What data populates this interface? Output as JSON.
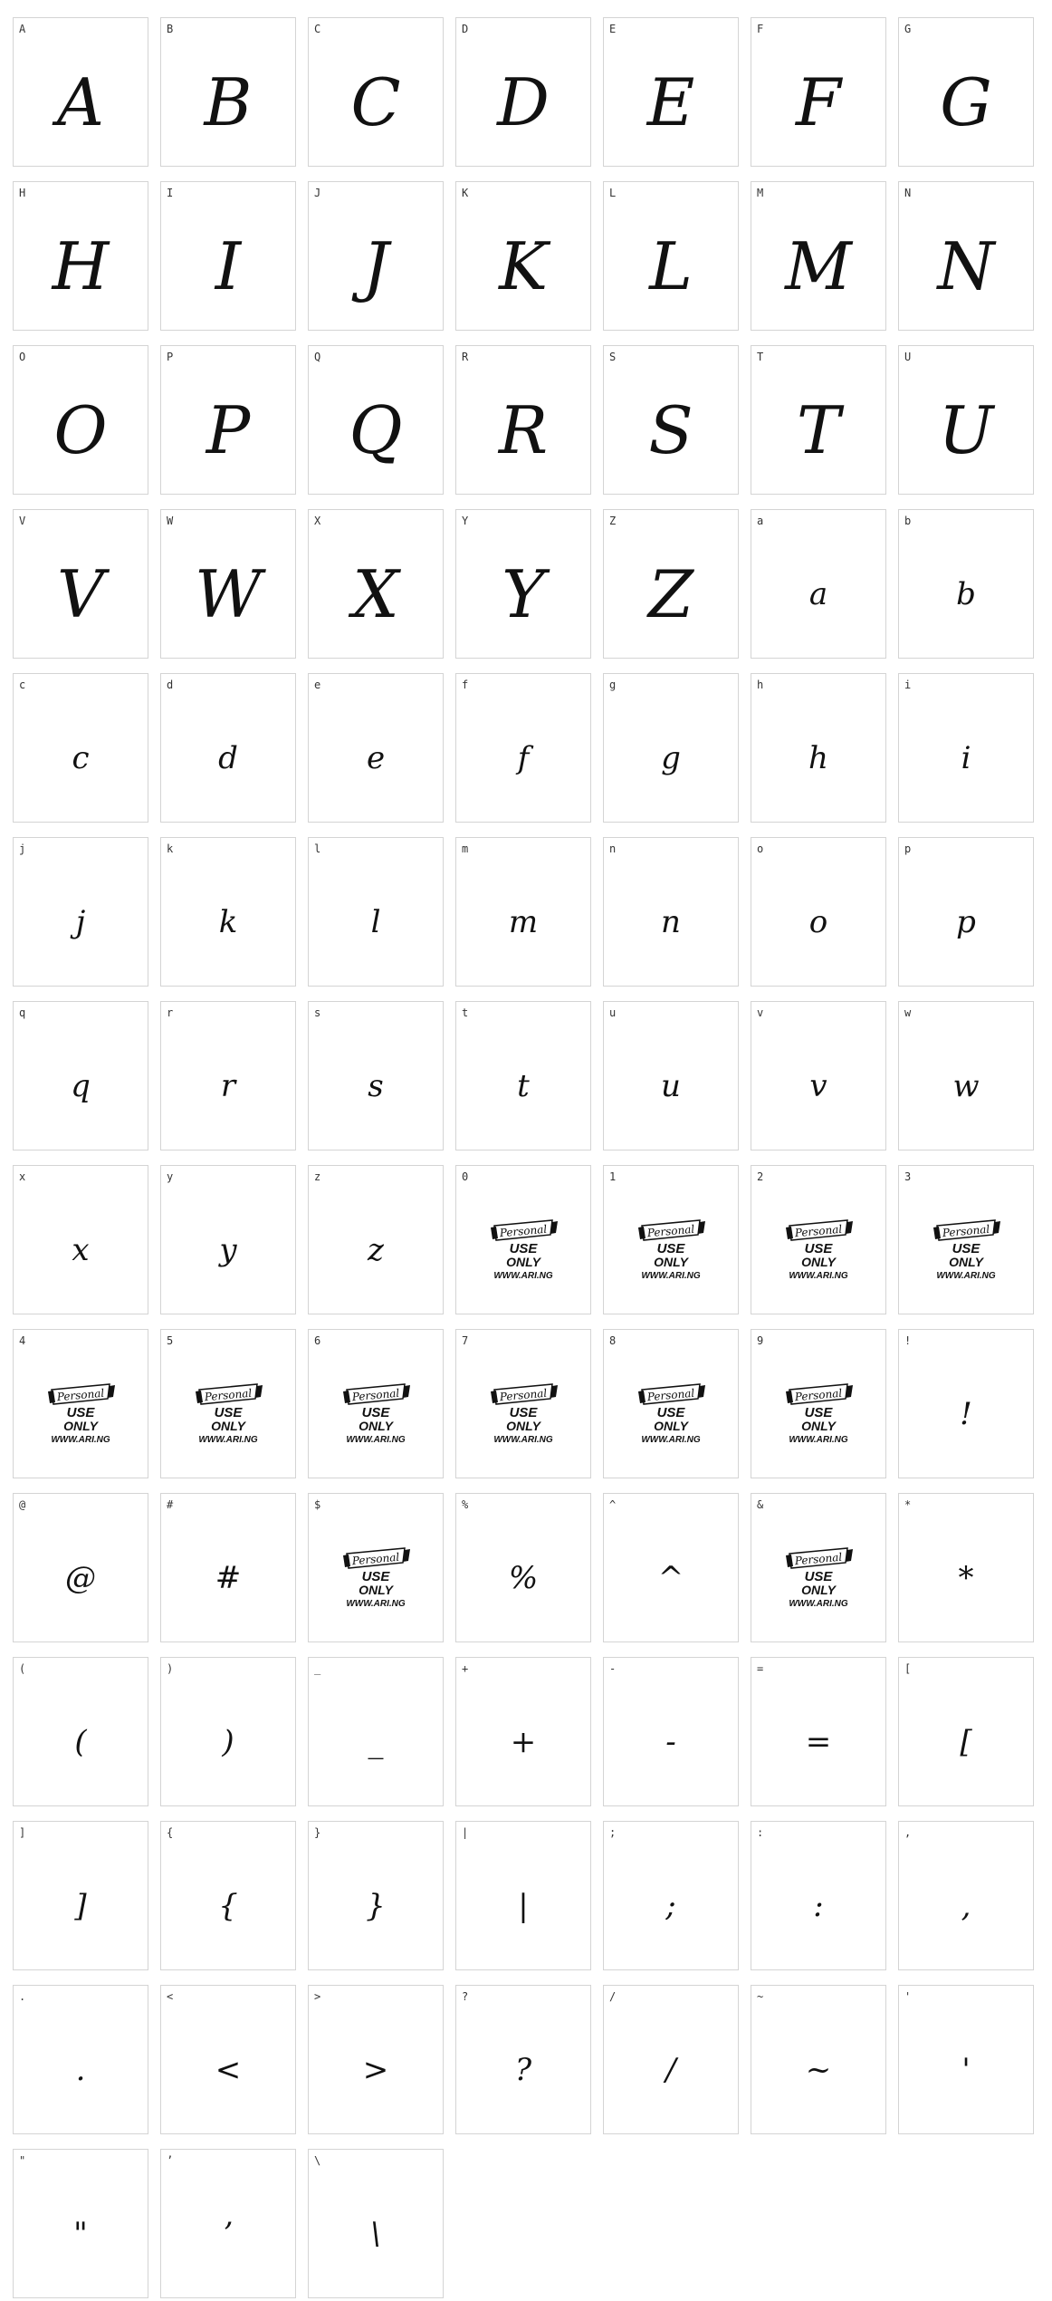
{
  "badge": {
    "line1": "Personal",
    "line2": "USE",
    "line3": "ONLY",
    "line4": "WWW.ARI.NG"
  },
  "cells": [
    {
      "label": "A",
      "glyph": "A",
      "kind": "upper"
    },
    {
      "label": "B",
      "glyph": "B",
      "kind": "upper"
    },
    {
      "label": "C",
      "glyph": "C",
      "kind": "upper"
    },
    {
      "label": "D",
      "glyph": "D",
      "kind": "upper"
    },
    {
      "label": "E",
      "glyph": "E",
      "kind": "upper"
    },
    {
      "label": "F",
      "glyph": "F",
      "kind": "upper"
    },
    {
      "label": "G",
      "glyph": "G",
      "kind": "upper"
    },
    {
      "label": "H",
      "glyph": "H",
      "kind": "upper"
    },
    {
      "label": "I",
      "glyph": "I",
      "kind": "upper"
    },
    {
      "label": "J",
      "glyph": "J",
      "kind": "upper"
    },
    {
      "label": "K",
      "glyph": "K",
      "kind": "upper"
    },
    {
      "label": "L",
      "glyph": "L",
      "kind": "upper"
    },
    {
      "label": "M",
      "glyph": "M",
      "kind": "upper"
    },
    {
      "label": "N",
      "glyph": "N",
      "kind": "upper"
    },
    {
      "label": "O",
      "glyph": "O",
      "kind": "upper"
    },
    {
      "label": "P",
      "glyph": "P",
      "kind": "upper"
    },
    {
      "label": "Q",
      "glyph": "Q",
      "kind": "upper"
    },
    {
      "label": "R",
      "glyph": "R",
      "kind": "upper"
    },
    {
      "label": "S",
      "glyph": "S",
      "kind": "upper"
    },
    {
      "label": "T",
      "glyph": "T",
      "kind": "upper"
    },
    {
      "label": "U",
      "glyph": "U",
      "kind": "upper"
    },
    {
      "label": "V",
      "glyph": "V",
      "kind": "upper"
    },
    {
      "label": "W",
      "glyph": "W",
      "kind": "upper"
    },
    {
      "label": "X",
      "glyph": "X",
      "kind": "upper"
    },
    {
      "label": "Y",
      "glyph": "Y",
      "kind": "upper"
    },
    {
      "label": "Z",
      "glyph": "Z",
      "kind": "upper"
    },
    {
      "label": "a",
      "glyph": "a",
      "kind": "lower"
    },
    {
      "label": "b",
      "glyph": "b",
      "kind": "lower"
    },
    {
      "label": "c",
      "glyph": "c",
      "kind": "lower"
    },
    {
      "label": "d",
      "glyph": "d",
      "kind": "lower"
    },
    {
      "label": "e",
      "glyph": "e",
      "kind": "lower"
    },
    {
      "label": "f",
      "glyph": "f",
      "kind": "lower"
    },
    {
      "label": "g",
      "glyph": "g",
      "kind": "lower"
    },
    {
      "label": "h",
      "glyph": "h",
      "kind": "lower"
    },
    {
      "label": "i",
      "glyph": "i",
      "kind": "lower"
    },
    {
      "label": "j",
      "glyph": "j",
      "kind": "lower"
    },
    {
      "label": "k",
      "glyph": "k",
      "kind": "lower"
    },
    {
      "label": "l",
      "glyph": "l",
      "kind": "lower"
    },
    {
      "label": "m",
      "glyph": "m",
      "kind": "lower"
    },
    {
      "label": "n",
      "glyph": "n",
      "kind": "lower"
    },
    {
      "label": "o",
      "glyph": "o",
      "kind": "lower"
    },
    {
      "label": "p",
      "glyph": "p",
      "kind": "lower"
    },
    {
      "label": "q",
      "glyph": "q",
      "kind": "lower"
    },
    {
      "label": "r",
      "glyph": "r",
      "kind": "lower"
    },
    {
      "label": "s",
      "glyph": "s",
      "kind": "lower"
    },
    {
      "label": "t",
      "glyph": "t",
      "kind": "lower"
    },
    {
      "label": "u",
      "glyph": "u",
      "kind": "lower"
    },
    {
      "label": "v",
      "glyph": "v",
      "kind": "lower"
    },
    {
      "label": "w",
      "glyph": "w",
      "kind": "lower"
    },
    {
      "label": "x",
      "glyph": "x",
      "kind": "lower"
    },
    {
      "label": "y",
      "glyph": "y",
      "kind": "lower"
    },
    {
      "label": "z",
      "glyph": "z",
      "kind": "lower"
    },
    {
      "label": "0",
      "glyph": "",
      "kind": "badge"
    },
    {
      "label": "1",
      "glyph": "",
      "kind": "badge"
    },
    {
      "label": "2",
      "glyph": "",
      "kind": "badge"
    },
    {
      "label": "3",
      "glyph": "",
      "kind": "badge"
    },
    {
      "label": "4",
      "glyph": "",
      "kind": "badge"
    },
    {
      "label": "5",
      "glyph": "",
      "kind": "badge"
    },
    {
      "label": "6",
      "glyph": "",
      "kind": "badge"
    },
    {
      "label": "7",
      "glyph": "",
      "kind": "badge"
    },
    {
      "label": "8",
      "glyph": "",
      "kind": "badge"
    },
    {
      "label": "9",
      "glyph": "",
      "kind": "badge"
    },
    {
      "label": "!",
      "glyph": "!",
      "kind": "lower"
    },
    {
      "label": "@",
      "glyph": "@",
      "kind": "lower"
    },
    {
      "label": "#",
      "glyph": "#",
      "kind": "lower"
    },
    {
      "label": "$",
      "glyph": "",
      "kind": "badge"
    },
    {
      "label": "%",
      "glyph": "%",
      "kind": "lower"
    },
    {
      "label": "^",
      "glyph": "^",
      "kind": "lower"
    },
    {
      "label": "&",
      "glyph": "",
      "kind": "badge"
    },
    {
      "label": "*",
      "glyph": "*",
      "kind": "lower"
    },
    {
      "label": "(",
      "glyph": "(",
      "kind": "lower"
    },
    {
      "label": ")",
      "glyph": ")",
      "kind": "lower"
    },
    {
      "label": "_",
      "glyph": "_",
      "kind": "lower"
    },
    {
      "label": "+",
      "glyph": "+",
      "kind": "lower"
    },
    {
      "label": "-",
      "glyph": "-",
      "kind": "lower"
    },
    {
      "label": "=",
      "glyph": "=",
      "kind": "lower"
    },
    {
      "label": "[",
      "glyph": "[",
      "kind": "lower"
    },
    {
      "label": "]",
      "glyph": "]",
      "kind": "lower"
    },
    {
      "label": "{",
      "glyph": "{",
      "kind": "lower"
    },
    {
      "label": "}",
      "glyph": "}",
      "kind": "lower"
    },
    {
      "label": "|",
      "glyph": "|",
      "kind": "lower"
    },
    {
      "label": ";",
      "glyph": ";",
      "kind": "lower"
    },
    {
      "label": ":",
      "glyph": ":",
      "kind": "lower"
    },
    {
      "label": ",",
      "glyph": ",",
      "kind": "lower"
    },
    {
      "label": ".",
      "glyph": ".",
      "kind": "lower"
    },
    {
      "label": "<",
      "glyph": "<",
      "kind": "lower"
    },
    {
      "label": ">",
      "glyph": ">",
      "kind": "lower"
    },
    {
      "label": "?",
      "glyph": "?",
      "kind": "lower"
    },
    {
      "label": "/",
      "glyph": "/",
      "kind": "lower"
    },
    {
      "label": "~",
      "glyph": "~",
      "kind": "lower"
    },
    {
      "label": "'",
      "glyph": "'",
      "kind": "lower"
    },
    {
      "label": "\"",
      "glyph": "\"",
      "kind": "lower"
    },
    {
      "label": "’",
      "glyph": "’",
      "kind": "lower"
    },
    {
      "label": "\\",
      "glyph": "\\",
      "kind": "lower"
    }
  ]
}
